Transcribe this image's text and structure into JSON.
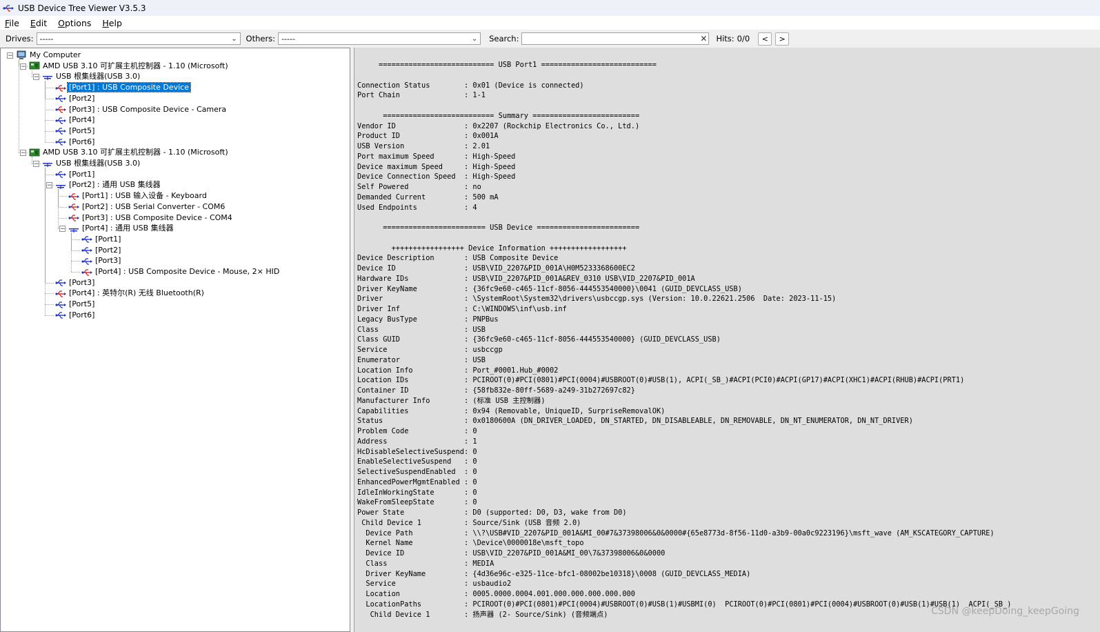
{
  "window": {
    "title": "USB Device Tree Viewer V3.5.3"
  },
  "menu": [
    {
      "underline": "F",
      "rest": "ile"
    },
    {
      "underline": "E",
      "rest": "dit"
    },
    {
      "underline": "O",
      "rest": "ptions"
    },
    {
      "underline": "H",
      "rest": "elp"
    }
  ],
  "toolbar": {
    "drives_label": "Drives:",
    "drives_value": "-----",
    "others_label": "Others:",
    "others_value": "-----",
    "search_label": "Search:",
    "search_value": "",
    "hits_label": "Hits:",
    "hits_value": "0/0",
    "prev_label": "<",
    "next_label": ">"
  },
  "tree": [
    {
      "label": "My Computer",
      "icon": "computer-icon",
      "level": 0,
      "expanded": true
    },
    {
      "label": "AMD USB 3.10 可扩展主机控制器 - 1.10 (Microsoft)",
      "icon": "host-controller-icon",
      "level": 1,
      "expanded": true
    },
    {
      "label": "USB 根集线器(USB 3.0)",
      "icon": "root-hub-icon",
      "level": 2,
      "expanded": true
    },
    {
      "label": "[Port1] : USB Composite Device",
      "icon": "usb-device-icon",
      "level": 3,
      "selected": true
    },
    {
      "label": "[Port2]",
      "icon": "usb-port-icon",
      "level": 3
    },
    {
      "label": "[Port3] : USB Composite Device - Camera",
      "icon": "usb-device-icon",
      "level": 3
    },
    {
      "label": "[Port4]",
      "icon": "usb-port-icon",
      "level": 3
    },
    {
      "label": "[Port5]",
      "icon": "usb-port-icon",
      "level": 3
    },
    {
      "label": "[Port6]",
      "icon": "usb-port-icon",
      "level": 3
    },
    {
      "label": "AMD USB 3.10 可扩展主机控制器 - 1.10 (Microsoft)",
      "icon": "host-controller-icon",
      "level": 1,
      "expanded": true
    },
    {
      "label": "USB 根集线器(USB 3.0)",
      "icon": "root-hub-icon",
      "level": 2,
      "expanded": true
    },
    {
      "label": "[Port1]",
      "icon": "usb-port-icon",
      "level": 3
    },
    {
      "label": "[Port2] : 通用 USB 集线器",
      "icon": "hub-icon",
      "level": 3,
      "expanded": true
    },
    {
      "label": "[Port1] : USB 输入设备 - Keyboard",
      "icon": "usb-device-icon",
      "level": 4
    },
    {
      "label": "[Port2] : USB Serial Converter - COM6",
      "icon": "usb-device-icon",
      "level": 4
    },
    {
      "label": "[Port3] : USB Composite Device - COM4",
      "icon": "usb-device-icon",
      "level": 4
    },
    {
      "label": "[Port4] : 通用 USB 集线器",
      "icon": "hub-icon",
      "level": 4,
      "expanded": true
    },
    {
      "label": "[Port1]",
      "icon": "usb-port-icon",
      "level": 5
    },
    {
      "label": "[Port2]",
      "icon": "usb-port-icon",
      "level": 5
    },
    {
      "label": "[Port3]",
      "icon": "usb-port-icon",
      "level": 5
    },
    {
      "label": "[Port4] : USB Composite Device - Mouse, 2× HID",
      "icon": "usb-device-icon",
      "level": 5
    },
    {
      "label": "[Port3]",
      "icon": "usb-port-icon",
      "level": 3
    },
    {
      "label": "[Port4] : 英特尔(R) 无线 Bluetooth(R)",
      "icon": "usb-device-icon",
      "level": 3
    },
    {
      "label": "[Port5]",
      "icon": "usb-port-icon",
      "level": 3
    },
    {
      "label": "[Port6]",
      "icon": "usb-port-icon",
      "level": 3
    }
  ],
  "details": [
    "     =========================== USB Port1 ===========================",
    "",
    "Connection Status        : 0x01 (Device is connected)",
    "Port Chain               : 1-1",
    "",
    "      ========================== Summary =========================",
    "Vendor ID                : 0x2207 (Rockchip Electronics Co., Ltd.)",
    "Product ID               : 0x001A",
    "USB Version              : 2.01",
    "Port maximum Speed       : High-Speed",
    "Device maximum Speed     : High-Speed",
    "Device Connection Speed  : High-Speed",
    "Self Powered             : no",
    "Demanded Current         : 500 mA",
    "Used Endpoints           : 4",
    "",
    "      ======================== USB Device ========================",
    "",
    "        +++++++++++++++++ Device Information ++++++++++++++++++",
    "Device Description       : USB Composite Device",
    "Device ID                : USB\\VID_2207&PID_001A\\H0M5233368600EC2",
    "Hardware IDs             : USB\\VID_2207&PID_001A&REV_0310 USB\\VID_2207&PID_001A",
    "Driver KeyName           : {36fc9e60-c465-11cf-8056-444553540000}\\0041 (GUID_DEVCLASS_USB)",
    "Driver                   : \\SystemRoot\\System32\\drivers\\usbccgp.sys (Version: 10.0.22621.2506  Date: 2023-11-15)",
    "Driver Inf               : C:\\WINDOWS\\inf\\usb.inf",
    "Legacy BusType           : PNPBus",
    "Class                    : USB",
    "Class GUID               : {36fc9e60-c465-11cf-8056-444553540000} (GUID_DEVCLASS_USB)",
    "Service                  : usbccgp",
    "Enumerator               : USB",
    "Location Info            : Port_#0001.Hub_#0002",
    "Location IDs             : PCIROOT(0)#PCI(0801)#PCI(0004)#USBROOT(0)#USB(1), ACPI(_SB_)#ACPI(PCI0)#ACPI(GP17)#ACPI(XHC1)#ACPI(RHUB)#ACPI(PRT1)",
    "Container ID             : {58fb832e-80ff-5689-a249-31b272697c82}",
    "Manufacturer Info        : (标准 USB 主控制器)",
    "Capabilities             : 0x94 (Removable, UniqueID, SurpriseRemovalOK)",
    "Status                   : 0x0180600A (DN_DRIVER_LOADED, DN_STARTED, DN_DISABLEABLE, DN_REMOVABLE, DN_NT_ENUMERATOR, DN_NT_DRIVER)",
    "Problem Code             : 0",
    "Address                  : 1",
    "HcDisableSelectiveSuspend: 0",
    "EnableSelectiveSuspend   : 0",
    "SelectiveSuspendEnabled  : 0",
    "EnhancedPowerMgmtEnabled : 0",
    "IdleInWorkingState       : 0",
    "WakeFromSleepState       : 0",
    "Power State              : D0 (supported: D0, D3, wake from D0)",
    " Child Device 1          : Source/Sink (USB 音频 2.0)",
    "  Device Path            : \\\\?\\USB#VID_2207&PID_001A&MI_00#7&37398006&0&0000#{65e8773d-8f56-11d0-a3b9-00a0c9223196}\\msft_wave (AM_KSCATEGORY_CAPTURE)",
    "  Kernel Name            : \\Device\\0000018e\\msft_topo",
    "  Device ID              : USB\\VID_2207&PID_001A&MI_00\\7&37398006&0&0000",
    "  Class                  : MEDIA",
    "  Driver KeyName         : {4d36e96c-e325-11ce-bfc1-08002be10318}\\0008 (GUID_DEVCLASS_MEDIA)",
    "  Service                : usbaudio2",
    "  Location               : 0005.0000.0004.001.000.000.000.000.000",
    "  LocationPaths          : PCIROOT(0)#PCI(0801)#PCI(0004)#USBROOT(0)#USB(1)#USBMI(0)  PCIROOT(0)#PCI(0801)#PCI(0004)#USBROOT(0)#USB(1)#USB(1)  ACPI(_SB_)",
    "   Child Device 1        : 扬声器 (2- Source/Sink) (音频端点)"
  ],
  "watermark": "CSDN @keepDoing_keepGoing"
}
